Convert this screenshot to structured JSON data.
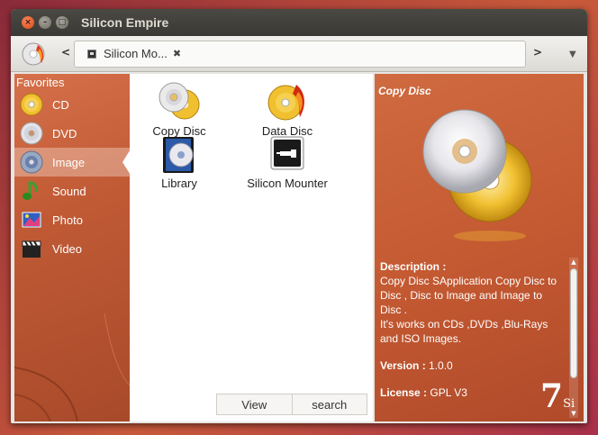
{
  "window": {
    "title": "Silicon Empire"
  },
  "toolbar": {
    "back": "<",
    "forward": ">",
    "tab_label": "Silicon Mo...",
    "tab_close": "✖",
    "dropdown": "▼"
  },
  "sidebar": {
    "heading": "Favorites",
    "items": [
      {
        "label": "CD",
        "icon": "cd-icon"
      },
      {
        "label": "DVD",
        "icon": "dvd-icon"
      },
      {
        "label": "Image",
        "icon": "image-icon",
        "selected": true
      },
      {
        "label": "Sound",
        "icon": "music-note-icon"
      },
      {
        "label": "Photo",
        "icon": "photo-icon"
      },
      {
        "label": "Video",
        "icon": "clapperboard-icon"
      }
    ]
  },
  "apps": [
    {
      "label": "Copy Disc",
      "icon": "copy-disc-icon"
    },
    {
      "label": "Data Disc",
      "icon": "data-disc-icon"
    },
    {
      "label": "Library",
      "icon": "library-icon"
    },
    {
      "label": "Silicon Mounter",
      "icon": "silicon-mounter-icon"
    }
  ],
  "bottom": {
    "view": "View",
    "search": "search"
  },
  "detail": {
    "title": "Copy Disc",
    "description_label": "Description :",
    "description_text_1": "Copy Disc SApplication Copy Disc to Disc , Disc to Image and Image to Disc .",
    "description_text_2": "It's works on CDs ,DVDs ,Blu-Rays and ISO Images.",
    "version_label": "Version :",
    "version_value": "1.0.0",
    "license_label": "License :",
    "license_value": "GPL V3",
    "logo_main": "7",
    "logo_sub": "Si"
  },
  "colors": {
    "sidebar_bg": "#c05a35",
    "detail_bg": "#c45a32",
    "titlebar_bg": "#3c3b37",
    "close_button": "#dd4814"
  }
}
